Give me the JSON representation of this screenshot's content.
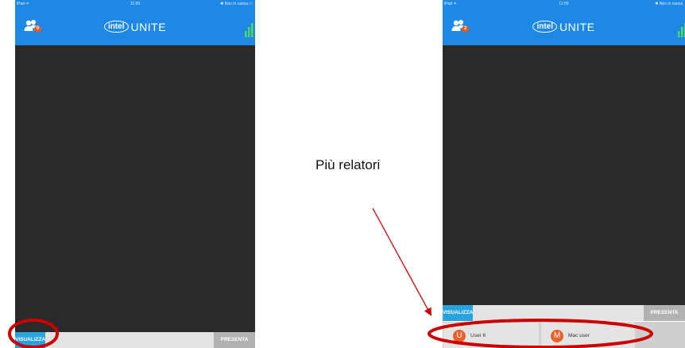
{
  "left_device": {
    "status": {
      "carrier": "iPad ᯤ",
      "time": "11:59",
      "battery": "✱ Non in carica ▭"
    },
    "badge_count": "0",
    "brand": {
      "logo": "intel",
      "name": "UNITE"
    },
    "tabs": {
      "view": "VISUALIZZA",
      "present": "PRESENTA"
    }
  },
  "right_device": {
    "status": {
      "carrier": "iPad ᯤ",
      "time": "11:59",
      "battery": "✱ Non in carica"
    },
    "badge_count": "2",
    "brand": {
      "logo": "intel",
      "name": "UNITE"
    },
    "tabs": {
      "view": "VISUALIZZA",
      "present": "PRESENTA"
    },
    "presenters": [
      {
        "initial": "U",
        "name": "User 6"
      },
      {
        "initial": "M",
        "name": "Mac user"
      }
    ]
  },
  "caption": "Più relatori",
  "colors": {
    "brand_blue": "#1e88e5",
    "highlight_red": "#cc0000",
    "avatar_orange": "#e8632b",
    "tab_view_blue": "#29a3e0"
  },
  "icons": {
    "participants": "participants-icon",
    "signal": "signal-bars-icon"
  }
}
